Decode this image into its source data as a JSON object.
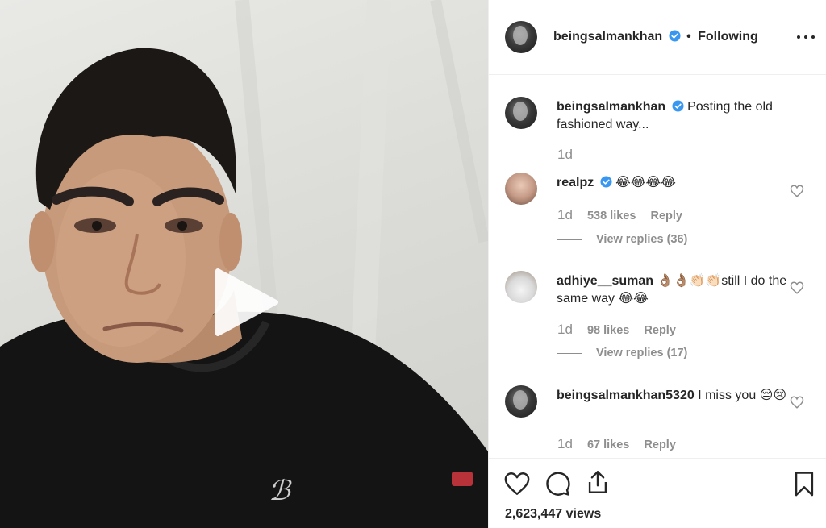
{
  "header": {
    "username": "beingsalmankhan",
    "separator": "•",
    "follow_status": "Following"
  },
  "caption": {
    "username": "beingsalmankhan",
    "text": "Posting the old fashioned way...",
    "time": "1d"
  },
  "comments": [
    {
      "username": "realpz",
      "verified": true,
      "text": "😂😂😂😂",
      "time": "1d",
      "likes": "538 likes",
      "reply": "Reply",
      "view_replies": "View replies (36)"
    },
    {
      "username": "adhiye__suman",
      "verified": false,
      "text": "👌🏽👌🏽👏🏻👏🏻still I do the same way 😂😂",
      "time": "1d",
      "likes": "98 likes",
      "reply": "Reply",
      "view_replies": "View replies (17)"
    },
    {
      "username": "beingsalmankhan5320",
      "verified": false,
      "text": "I miss you 😔😢",
      "time": "1d",
      "likes": "67 likes",
      "reply": "Reply"
    }
  ],
  "footer": {
    "views_count": "2,623,447",
    "views_label": "views"
  },
  "icons": {
    "like": "heart-outline-icon",
    "comment": "comment-bubble-icon",
    "share": "share-upload-icon",
    "save": "bookmark-icon",
    "verified": "verified-badge-icon",
    "more": "more-options-icon",
    "play": "play-icon"
  },
  "colors": {
    "verified_blue": "#3897f0",
    "text_primary": "#262626",
    "text_secondary": "#8e8e8e"
  }
}
